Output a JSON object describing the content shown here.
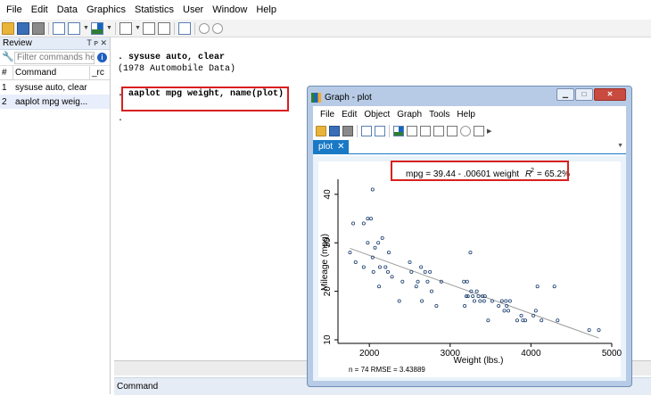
{
  "menubar": [
    "File",
    "Edit",
    "Data",
    "Graphics",
    "Statistics",
    "User",
    "Window",
    "Help"
  ],
  "review": {
    "title": "Review",
    "controls": "T ᴘ ✕",
    "filter_placeholder": "Filter commands he",
    "columns": [
      "#",
      "Command",
      "_rc"
    ],
    "rows": [
      {
        "num": "1",
        "cmd": "sysuse auto, clear"
      },
      {
        "num": "2",
        "cmd": "aaplot mpg weig..."
      }
    ]
  },
  "results": {
    "lines": [
      ". sysuse auto, clear",
      "(1978 Automobile Data)",
      ". aaplot mpg weight, name(plot)",
      "."
    ]
  },
  "command_window": {
    "label": "Command"
  },
  "graph_window": {
    "title": "Graph - plot",
    "menu": [
      "File",
      "Edit",
      "Object",
      "Graph",
      "Tools",
      "Help"
    ],
    "tab": "plot",
    "tab_close": "✕"
  },
  "chart_data": {
    "type": "scatter",
    "title": "mpg = 39.44 - .00601 weight",
    "r2_label": "R",
    "r2_sup": "2",
    "r2_value": "= 65.2%",
    "xlabel": "Weight (lbs.)",
    "ylabel": "Mileage (mpg)",
    "xlim": [
      1700,
      5000
    ],
    "ylim": [
      10,
      42
    ],
    "xticks": [
      2000,
      3000,
      4000,
      5000
    ],
    "yticks": [
      10,
      20,
      30,
      40
    ],
    "note": "n = 74    RMSE = 3.43889",
    "fit": {
      "intercept": 39.44,
      "slope": -0.00601
    },
    "marker_color": "#1a3d6e",
    "fit_color": "#9a9a9a",
    "points": [
      [
        1760,
        28
      ],
      [
        1800,
        34
      ],
      [
        1830,
        26
      ],
      [
        1930,
        25
      ],
      [
        1980,
        35
      ],
      [
        1980,
        30
      ],
      [
        2020,
        35
      ],
      [
        2040,
        41
      ],
      [
        2050,
        24
      ],
      [
        2070,
        29
      ],
      [
        2110,
        30
      ],
      [
        2120,
        21
      ],
      [
        2130,
        25
      ],
      [
        2160,
        31
      ],
      [
        2200,
        25
      ],
      [
        2230,
        24
      ],
      [
        2240,
        28
      ],
      [
        2280,
        23
      ],
      [
        2370,
        18
      ],
      [
        2410,
        22
      ],
      [
        2500,
        26
      ],
      [
        2520,
        24
      ],
      [
        2580,
        21
      ],
      [
        2600,
        22
      ],
      [
        2640,
        25
      ],
      [
        2650,
        18
      ],
      [
        2690,
        24
      ],
      [
        2720,
        22
      ],
      [
        2750,
        24
      ],
      [
        2770,
        20
      ],
      [
        2830,
        17
      ],
      [
        2890,
        22
      ],
      [
        3170,
        22
      ],
      [
        3180,
        17
      ],
      [
        3200,
        19
      ],
      [
        3210,
        22
      ],
      [
        3220,
        19
      ],
      [
        3250,
        28
      ],
      [
        3260,
        20
      ],
      [
        3280,
        19
      ],
      [
        3300,
        18
      ],
      [
        3330,
        20
      ],
      [
        3350,
        19
      ],
      [
        3370,
        18
      ],
      [
        3400,
        19
      ],
      [
        3420,
        18
      ],
      [
        3430,
        19
      ],
      [
        3470,
        14
      ],
      [
        3520,
        18
      ],
      [
        3600,
        17
      ],
      [
        3640,
        18
      ],
      [
        3670,
        16
      ],
      [
        3690,
        18
      ],
      [
        3700,
        17
      ],
      [
        3720,
        16
      ],
      [
        3740,
        18
      ],
      [
        3830,
        14
      ],
      [
        3880,
        15
      ],
      [
        3900,
        14
      ],
      [
        3930,
        14
      ],
      [
        4030,
        15
      ],
      [
        4060,
        16
      ],
      [
        4080,
        21
      ],
      [
        4130,
        14
      ],
      [
        4290,
        21
      ],
      [
        4330,
        14
      ],
      [
        4720,
        12
      ],
      [
        4840,
        12
      ],
      [
        1930,
        34
      ],
      [
        2040,
        27
      ]
    ]
  }
}
